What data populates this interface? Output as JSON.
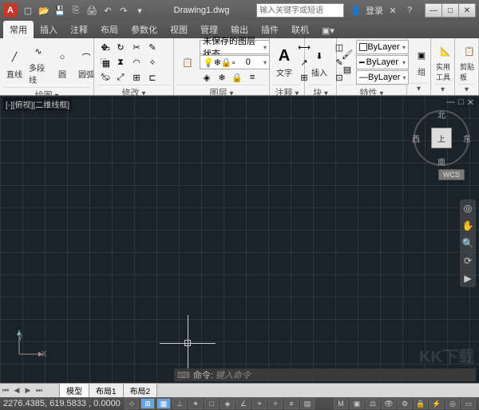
{
  "title": "Drawing1.dwg",
  "search_placeholder": "输入关键字或短语",
  "login": "登录",
  "qat": [
    "new",
    "open",
    "save",
    "undo",
    "redo",
    "print",
    "more"
  ],
  "tabs": [
    "常用",
    "插入",
    "注释",
    "布局",
    "参数化",
    "视图",
    "管理",
    "输出",
    "插件",
    "联机"
  ],
  "active_tab": 0,
  "ribbon": {
    "draw": {
      "label": "绘图",
      "line": "直线",
      "polyline": "多段线",
      "circle": "圆",
      "arc": "圆弧"
    },
    "modify": {
      "label": "修改"
    },
    "layers": {
      "label": "图层",
      "state": "未保存的图层状态",
      "current": "0"
    },
    "annotation": {
      "label": "注释",
      "text": "文字"
    },
    "block": {
      "label": "块",
      "insert": "插入"
    },
    "properties": {
      "label": "特性",
      "bylayer": "ByLayer"
    },
    "group": {
      "label": "组"
    },
    "utilities": {
      "label": "实用工具"
    },
    "clipboard": {
      "label": "剪贴板"
    }
  },
  "viewport_label": "[-][俯视][二维线框]",
  "viewcube": {
    "top": "上",
    "n": "北",
    "s": "南",
    "e": "东",
    "w": "西",
    "wcs": "WCS"
  },
  "ucs": {
    "x": "X",
    "y": "Y"
  },
  "model_tabs": [
    "模型",
    "布局1",
    "布局2"
  ],
  "active_model_tab": 0,
  "command_prompt": "键入命令",
  "command_label": "命令:",
  "coords": "2276.4385, 619.5833 , 0.0000",
  "status_toggles": [
    "INFER",
    "SNAP",
    "GRID",
    "ORTHO",
    "POLAR",
    "OSNAP",
    "3DOSNAP",
    "OTRACK",
    "DUCS",
    "DYN",
    "LWT",
    "TPY",
    "QP",
    "SC"
  ],
  "watermark": "KK下载"
}
